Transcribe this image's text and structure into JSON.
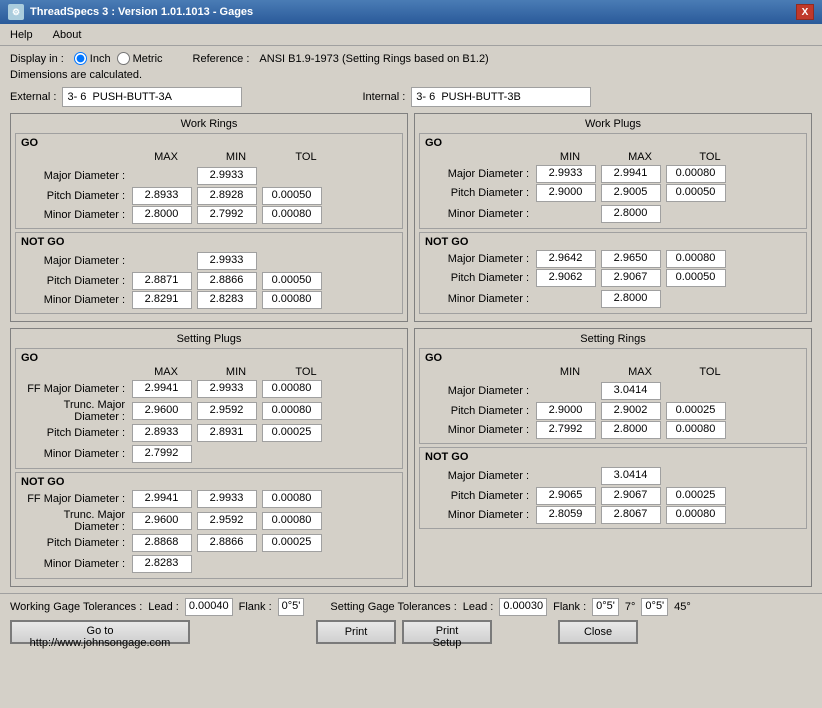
{
  "titleBar": {
    "title": "ThreadSpecs 3 : Version 1.01.1013 - Gages",
    "closeLabel": "X"
  },
  "menu": {
    "items": [
      "Help",
      "About"
    ]
  },
  "displayIn": {
    "label": "Display in :",
    "options": [
      "Inch",
      "Metric"
    ],
    "selected": "Inch"
  },
  "reference": {
    "label": "Reference :",
    "value": "ANSI B1.9-1973 (Setting Rings based on B1.2)"
  },
  "dimensionsText": "Dimensions are calculated.",
  "external": {
    "label": "External :",
    "value": "3- 6  PUSH-BUTT-3A"
  },
  "internal": {
    "label": "Internal :",
    "value": "3- 6  PUSH-BUTT-3B"
  },
  "workRings": {
    "title": "Work Rings",
    "go": {
      "label": "GO",
      "cols": [
        "MAX",
        "MIN",
        "TOL"
      ],
      "rows": [
        {
          "label": "Major Diameter :",
          "max": "",
          "min": "2.9933",
          "tol": ""
        },
        {
          "label": "Pitch Diameter :",
          "max": "2.8933",
          "min": "2.8928",
          "tol": "0.00050"
        },
        {
          "label": "Minor Diameter :",
          "max": "2.8000",
          "min": "2.7992",
          "tol": "0.00080"
        }
      ]
    },
    "notgo": {
      "label": "NOT GO",
      "rows": [
        {
          "label": "Major Diameter :",
          "max": "",
          "min": "2.9933",
          "tol": ""
        },
        {
          "label": "Pitch Diameter :",
          "max": "2.8871",
          "min": "2.8866",
          "tol": "0.00050"
        },
        {
          "label": "Minor Diameter :",
          "max": "2.8291",
          "min": "2.8283",
          "tol": "0.00080"
        }
      ]
    }
  },
  "workPlugs": {
    "title": "Work Plugs",
    "go": {
      "label": "GO",
      "cols": [
        "MIN",
        "MAX",
        "TOL"
      ],
      "rows": [
        {
          "label": "Major Diameter :",
          "min": "2.9933",
          "max": "2.9941",
          "tol": "0.00080"
        },
        {
          "label": "Pitch Diameter :",
          "min": "2.9000",
          "max": "2.9005",
          "tol": "0.00050"
        },
        {
          "label": "Minor Diameter :",
          "min": "",
          "max": "2.8000",
          "tol": ""
        }
      ]
    },
    "notgo": {
      "label": "NOT GO",
      "rows": [
        {
          "label": "Major Diameter :",
          "min": "2.9642",
          "max": "2.9650",
          "tol": "0.00080"
        },
        {
          "label": "Pitch Diameter :",
          "min": "2.9062",
          "max": "2.9067",
          "tol": "0.00050"
        },
        {
          "label": "Minor Diameter :",
          "min": "",
          "max": "2.8000",
          "tol": ""
        }
      ]
    }
  },
  "settingPlugs": {
    "title": "Setting Plugs",
    "go": {
      "label": "GO",
      "cols": [
        "MAX",
        "MIN",
        "TOL"
      ],
      "rows": [
        {
          "label": "FF Major Diameter :",
          "max": "2.9941",
          "min": "2.9933",
          "tol": "0.00080"
        },
        {
          "label": "Trunc. Major Diameter :",
          "max": "2.9600",
          "min": "2.9592",
          "tol": "0.00080"
        },
        {
          "label": "Pitch Diameter :",
          "max": "2.8933",
          "min": "2.8931",
          "tol": "0.00025"
        },
        {
          "label": "Minor Diameter :",
          "max": "2.7992",
          "min": "",
          "tol": ""
        }
      ]
    },
    "notgo": {
      "label": "NOT GO",
      "rows": [
        {
          "label": "FF Major Diameter :",
          "max": "2.9941",
          "min": "2.9933",
          "tol": "0.00080"
        },
        {
          "label": "Trunc. Major Diameter :",
          "max": "2.9600",
          "min": "2.9592",
          "tol": "0.00080"
        },
        {
          "label": "Pitch Diameter :",
          "max": "2.8868",
          "min": "2.8866",
          "tol": "0.00025"
        },
        {
          "label": "Minor Diameter :",
          "max": "2.8283",
          "min": "",
          "tol": ""
        }
      ]
    }
  },
  "settingRings": {
    "title": "Setting Rings",
    "go": {
      "label": "GO",
      "cols": [
        "MIN",
        "MAX",
        "TOL"
      ],
      "rows": [
        {
          "label": "Major Diameter :",
          "min": "",
          "max": "3.0414",
          "tol": ""
        },
        {
          "label": "Pitch Diameter :",
          "min": "2.9000",
          "max": "2.9002",
          "tol": "0.00025"
        },
        {
          "label": "Minor Diameter :",
          "min": "2.7992",
          "max": "2.8000",
          "tol": "0.00080"
        }
      ]
    },
    "notgo": {
      "label": "NOT GO",
      "rows": [
        {
          "label": "Major Diameter :",
          "min": "",
          "max": "3.0414",
          "tol": ""
        },
        {
          "label": "Pitch Diameter :",
          "min": "2.9065",
          "max": "2.9067",
          "tol": "0.00025"
        },
        {
          "label": "Minor Diameter :",
          "min": "2.8059",
          "max": "2.8067",
          "tol": "0.00080"
        }
      ]
    }
  },
  "workingGageTolerances": {
    "label": "Working Gage Tolerances :",
    "leadLabel": "Lead :",
    "leadValue": "0.00040",
    "flankLabel": "Flank :",
    "flankValue": "0°5'"
  },
  "settingGageTolerances": {
    "label": "Setting Gage Tolerances :",
    "leadLabel": "Lead :",
    "leadValue": "0.00030",
    "flankLabel": "Flank :",
    "flank1": "0°5'",
    "deg": "7°",
    "flank2": "0°5'",
    "deg2": "45°"
  },
  "buttons": {
    "goto": "Go to http://www.johnsongage.com",
    "print": "Print",
    "printSetup": "Print Setup",
    "close": "Close"
  }
}
